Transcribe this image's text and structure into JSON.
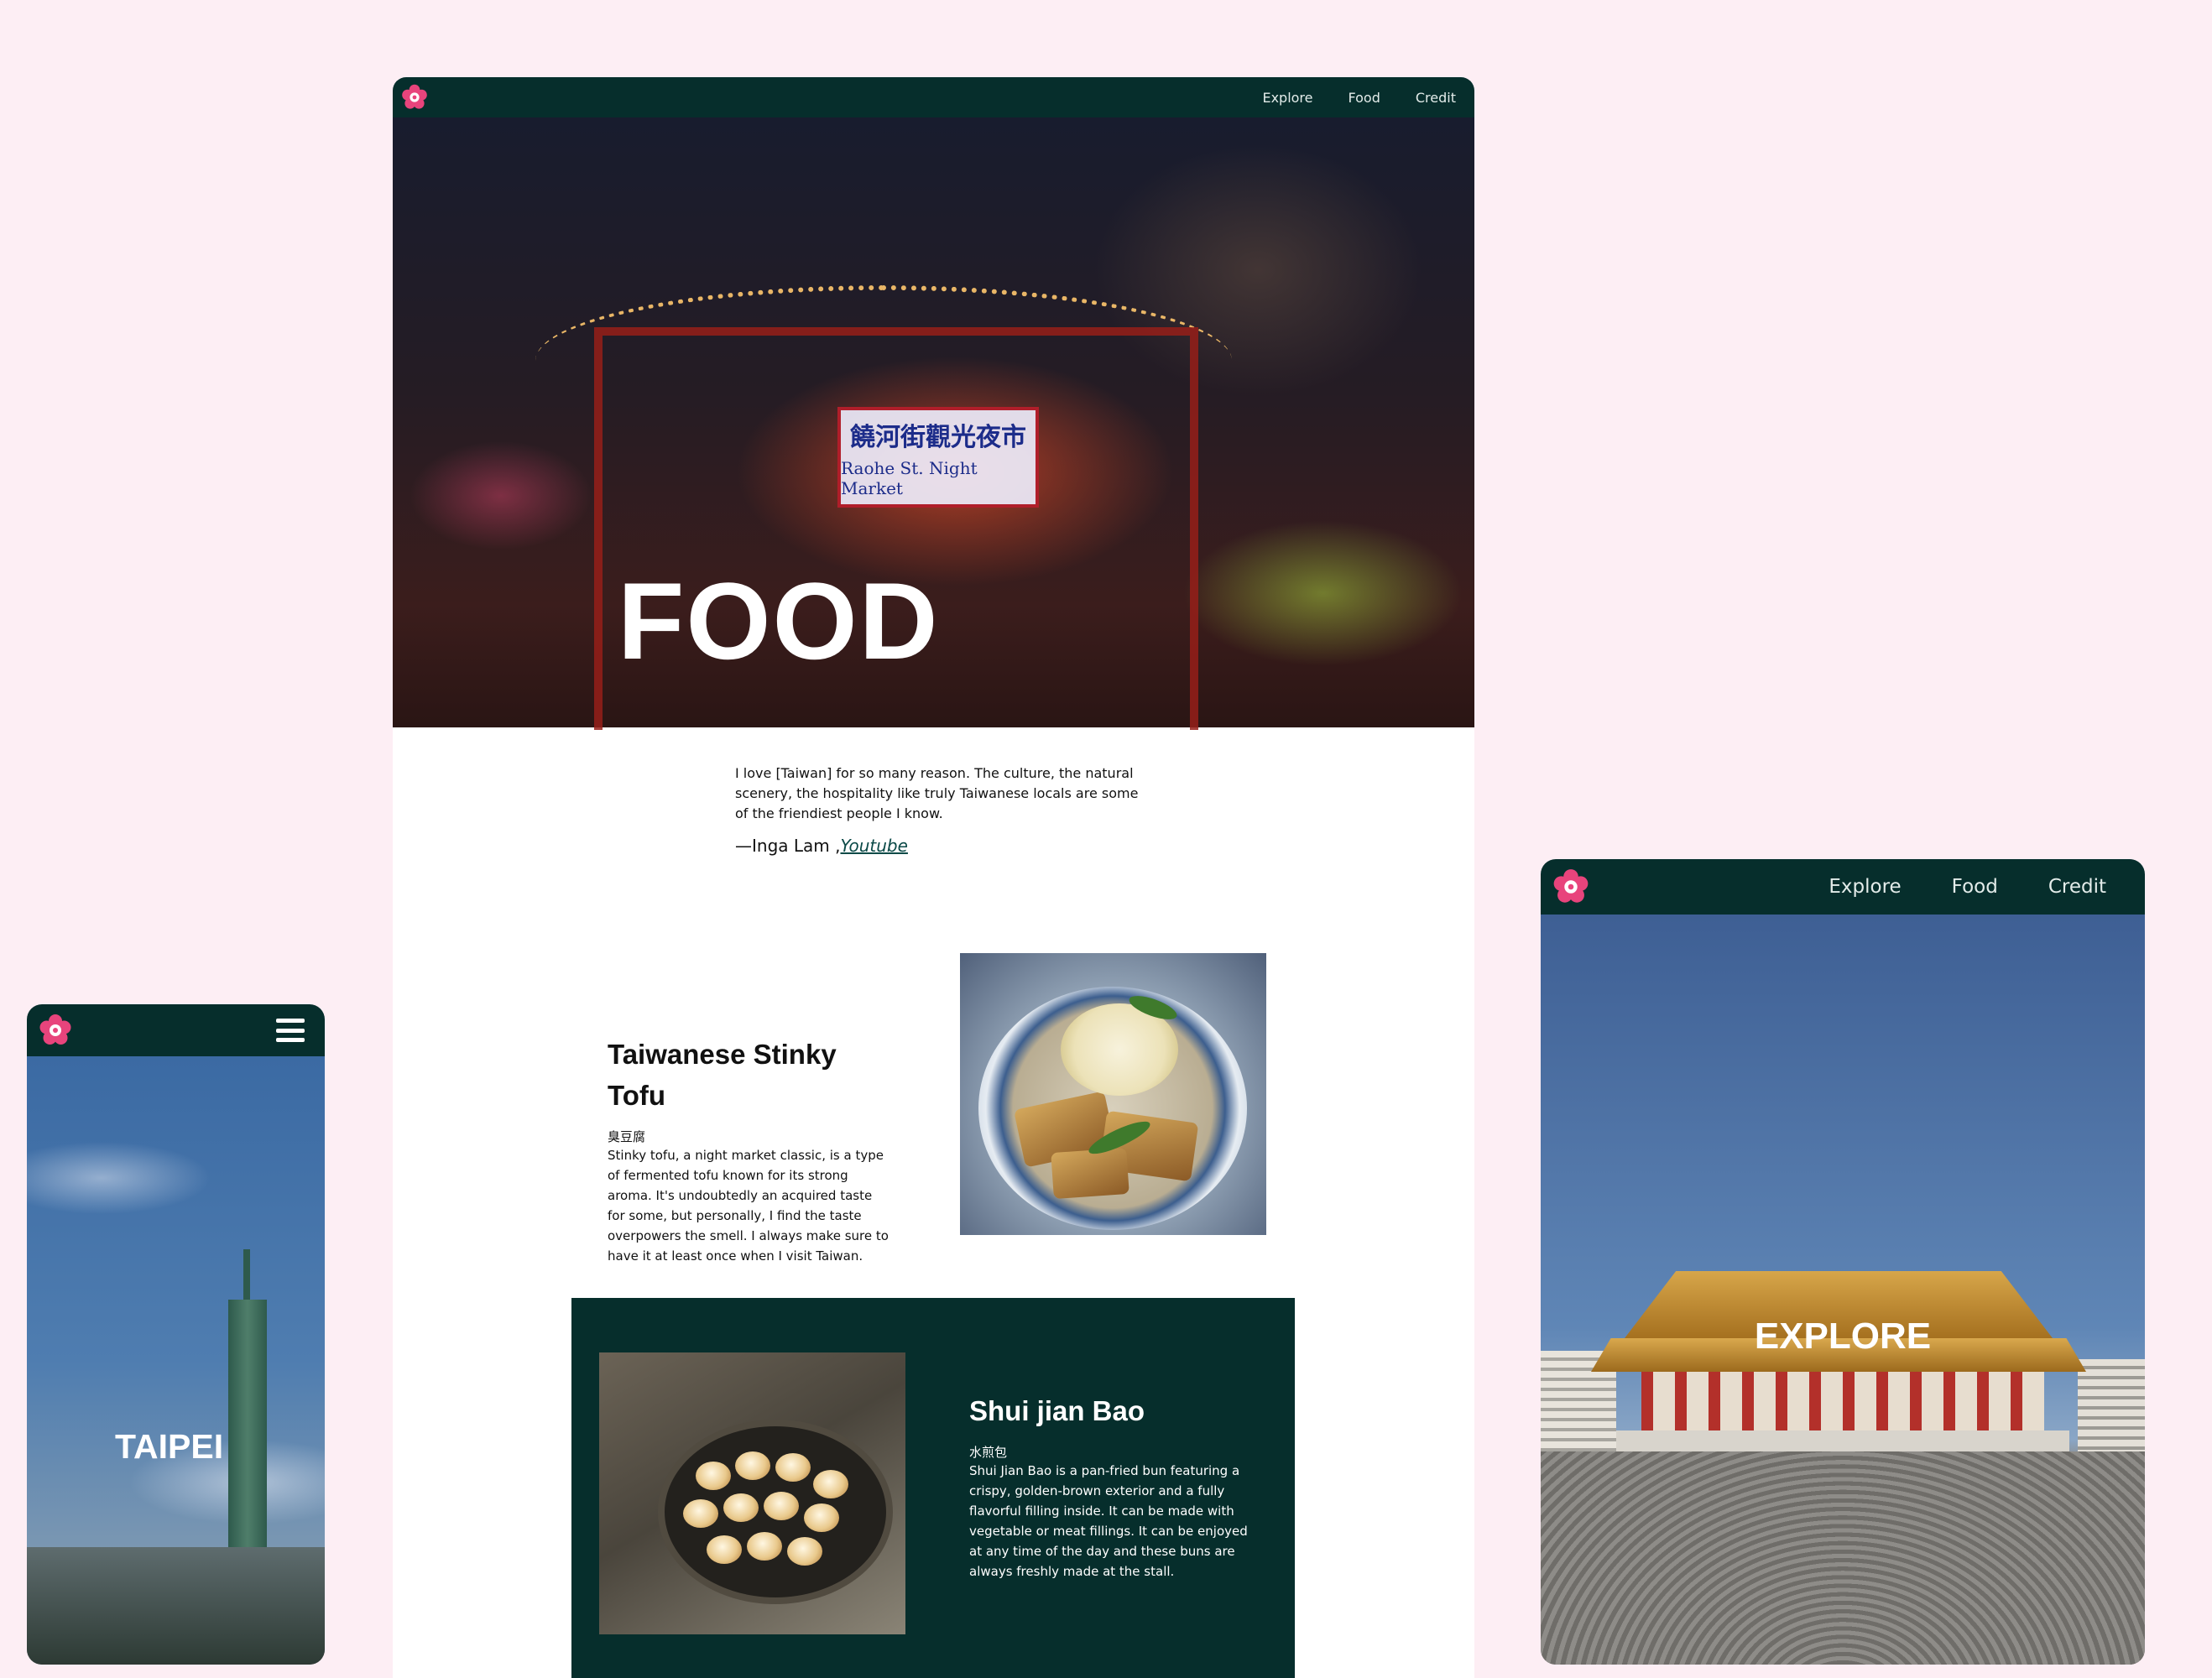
{
  "desktop": {
    "nav": [
      "Explore",
      "Food",
      "Credit"
    ],
    "hero": {
      "title": "FOOD",
      "sign_zh": "饒河街觀光夜市",
      "sign_en": "Raohe St. Night Market"
    },
    "quote": {
      "text": "I love [Taiwan] for so many reason. The culture, the natural scenery, the hospitality like truly Taiwanese locals are some of the friendiest people I know.",
      "author": "—Inga Lam ,",
      "link": "Youtube"
    },
    "dishes": [
      {
        "title": "Taiwanese Stinky Tofu",
        "chinese": "臭豆腐",
        "description": "Stinky tofu, a night market classic, is a type of fermented tofu known for its strong aroma. It's undoubtedly an acquired taste for some, but personally, I find the taste overpowers the smell. I always make sure to have it at least once when I visit Taiwan."
      },
      {
        "title": "Shui jian Bao",
        "chinese": "水煎包",
        "description": "Shui Jian Bao is a pan-fried bun featuring a crispy, golden-brown exterior and a fully flavorful filling inside. It can be made with vegetable or meat fillings. It can be enjoyed at any time of the day and these buns are always freshly made at the stall."
      }
    ]
  },
  "mobile": {
    "hero_title": "TAIPEI",
    "menu_icon": "hamburger-menu-icon"
  },
  "tablet": {
    "nav": [
      "Explore",
      "Food",
      "Credit"
    ],
    "hero_title": "EXPLORE"
  },
  "colors": {
    "background": "#fdeef4",
    "nav": "#062e2c",
    "accent_section": "#062e2c",
    "logo": "#e8447c"
  },
  "icons": {
    "logo": "plum-blossom-logo-icon"
  }
}
